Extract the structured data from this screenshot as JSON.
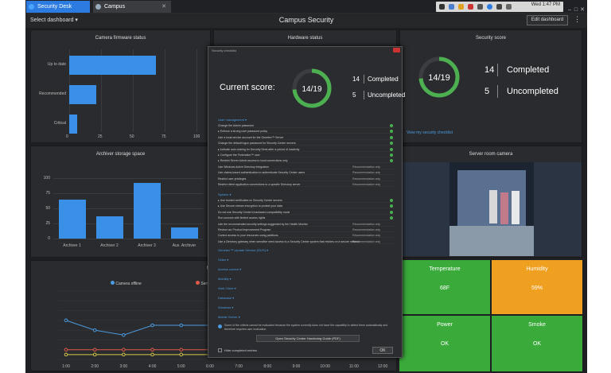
{
  "tabs": [
    {
      "label": "Security Desk"
    },
    {
      "label": "Campus"
    }
  ],
  "clock": "Wed 1:47 PM",
  "header": {
    "select_dashboard": "Select dashboard ▾",
    "title": "Campus Security",
    "edit_button": "Edit dashboard",
    "more": "⋮"
  },
  "firmware": {
    "title": "Camera firmware status",
    "chart_data": {
      "type": "bar",
      "orientation": "horizontal",
      "categories": [
        "Up to date",
        "Recommended",
        "Critical"
      ],
      "values": [
        68,
        21,
        6
      ],
      "xlim": [
        0,
        100
      ],
      "xticks": [
        "0",
        "25",
        "50",
        "75",
        "100"
      ]
    }
  },
  "archiver": {
    "title": "Archiver storage space",
    "chart_data": {
      "type": "bar",
      "categories": [
        "Archiver 1",
        "Archiver 2",
        "Archiver 3",
        "Aux. Archiver"
      ],
      "values": [
        64,
        37,
        92,
        19
      ],
      "ylim": [
        0,
        100
      ],
      "yticks": [
        "0",
        "25",
        "50",
        "75",
        "100"
      ]
    }
  },
  "maint": {
    "title": "Mainte",
    "legend": [
      "Camera offline",
      "Serv"
    ],
    "chart_data": {
      "type": "line",
      "x": [
        "1:00",
        "2:00",
        "3:00",
        "4:00",
        "5:00",
        "6:00",
        "7:00",
        "8:00",
        "9:00",
        "10:00",
        "11:00",
        "12:00"
      ],
      "series": [
        {
          "name": "Camera offline",
          "values": [
            8,
            6,
            5,
            7,
            7,
            7,
            7,
            7,
            7,
            7,
            7,
            7
          ]
        },
        {
          "name": "Serv",
          "values": [
            2,
            2,
            2,
            2,
            2,
            2,
            2,
            2,
            2,
            2,
            2,
            2
          ]
        },
        {
          "values": [
            1,
            1,
            1,
            1,
            1,
            1,
            1,
            1,
            1,
            1,
            1,
            1
          ]
        }
      ],
      "colors": [
        "#4a9be0",
        "#e05a4a",
        "#d6c84a"
      ],
      "ylim": [
        0,
        14
      ]
    }
  },
  "hardware": {
    "title": "Hardware status"
  },
  "score": {
    "title": "Security score",
    "ring": "14/19",
    "completed_n": "14",
    "completed_label": "Completed",
    "uncompleted_n": "5",
    "uncompleted_label": "Uncompleted",
    "link": "View my security checklist",
    "progress": 0.737
  },
  "camera": {
    "title": "Server room camera"
  },
  "sensors": [
    {
      "label": "Temperature",
      "value": "68F",
      "color": "#3aaa3a"
    },
    {
      "label": "Humidity",
      "value": "59%",
      "color": "#f0a020"
    },
    {
      "label": "Power",
      "value": "OK",
      "color": "#3aaa3a"
    },
    {
      "label": "Smoke",
      "value": "OK",
      "color": "#3aaa3a"
    }
  ],
  "modal": {
    "title": "Security checklist",
    "current_score_label": "Current score:",
    "ring": "14/19",
    "completed_n": "14",
    "completed_label": "Completed",
    "uncompleted_n": "5",
    "uncompleted_label": "Uncompleted",
    "section1": "User management ▾",
    "rows1": [
      {
        "text": "Change the Admin password",
        "rec": ""
      },
      {
        "text": "▸ Enforce a strong user password policy",
        "rec": ""
      },
      {
        "text": "Use a local service account for the Genetec™ Server",
        "rec": ""
      },
      {
        "text": "Change the default logon password for Security Center servers",
        "rec": ""
      },
      {
        "text": "▸ Activate auto-locking for Security Desk after a period of inactivity",
        "rec": ""
      },
      {
        "text": "▸ Configure the Federation™ user",
        "rec": ""
      },
      {
        "text": "▸ Restrict Server Admin access to local connections only",
        "rec": ""
      },
      {
        "text": "Use Windows Active Directory integration",
        "rec": "Recommendation only"
      },
      {
        "text": "Use claims-based authentication to authenticate Security Center users",
        "rec": "Recommendation only"
      },
      {
        "text": "Restrict user privileges",
        "rec": "Recommendation only"
      },
      {
        "text": "Restrict client application connections to a specific Directory server",
        "rec": "Recommendation only"
      }
    ],
    "section2": "System ▾",
    "rows2": [
      {
        "text": "▸ Use trusted certificates on Security Center servers",
        "rec": ""
      },
      {
        "text": "▸ Use Secure stream encryption to protect your data",
        "rec": ""
      },
      {
        "text": "Do not use Security Center's backward compatibility mode",
        "rec": ""
      },
      {
        "text": "Run sources with limited access rights",
        "rec": ""
      },
      {
        "text": "Use the recommended security settings suggested by the Health Monitor",
        "rec": "Recommendation only"
      },
      {
        "text": "Review our Product Improvement Program",
        "rec": "Recommendation only"
      },
      {
        "text": "Control access to your resources using partitions",
        "rec": "Recommendation only"
      },
      {
        "text": "Use a Directory gateway when sensitive need access to a Security Center system that resides on a secure network",
        "rec": "Recommendation only"
      }
    ],
    "collapsed": [
      "Genetec™ Update Service (GUS) ▾",
      "Video ▾",
      "Access control ▾",
      "Mobility ▾",
      "Web Client ▾",
      "Database ▾",
      "Windows ▾",
      "Mobile Server ▾"
    ],
    "footnote": "Some of the criteria cannot be evaluated because the system currently does not have the capability to detect them automatically and therefore requires user evaluation.",
    "guide_button": "Open Security Center Hardening Guide (PDF)",
    "hide_label": "Hide completed entries",
    "ok": "OK"
  }
}
